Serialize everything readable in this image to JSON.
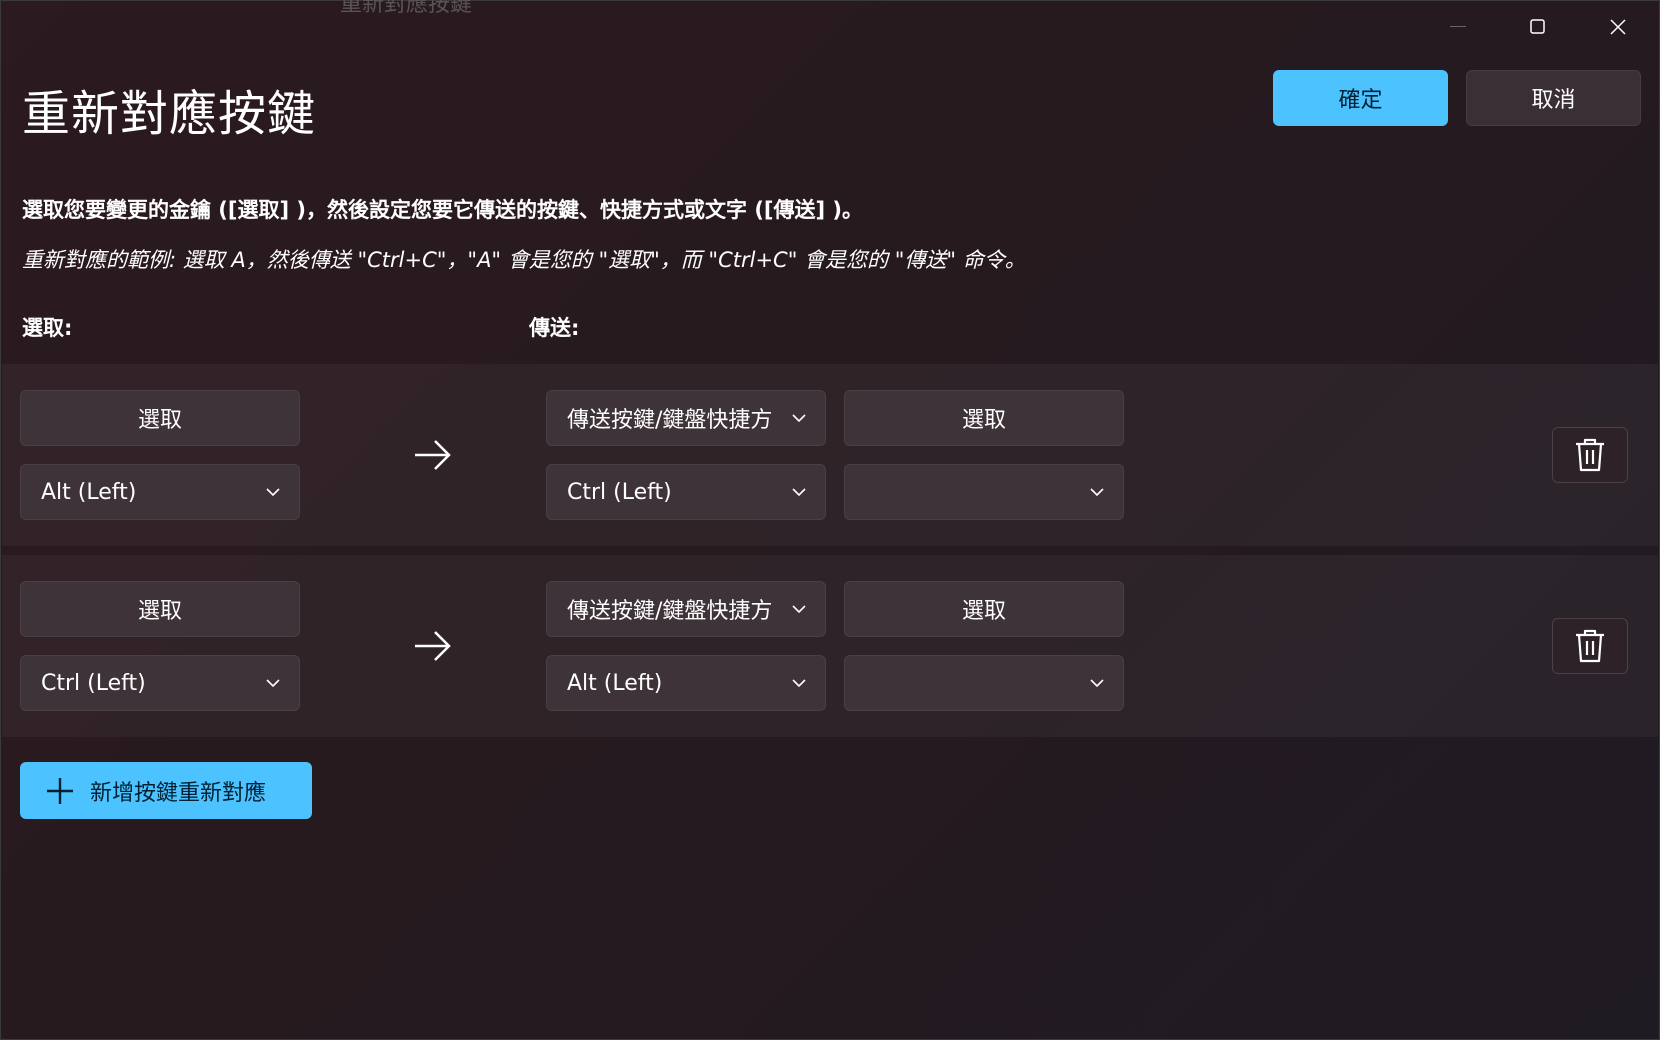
{
  "window": {
    "title": "重新對應按鍵",
    "controls": {
      "minimize": "minimize-icon",
      "maximize": "maximize-icon",
      "close": "close-icon"
    }
  },
  "header": {
    "title": "重新對應按鍵",
    "ok_label": "確定",
    "cancel_label": "取消"
  },
  "instructions": {
    "main": "選取您要變更的金鑰 ([選取] )，然後設定您要它傳送的按鍵、快捷方式或文字 ([傳送] )。",
    "example": "重新對應的範例: 選取 A，然後傳送 \"Ctrl+C\"，\"A\" 會是您的 \"選取\"，而 \"Ctrl+C\" 會是您的 \"傳送\" 命令。"
  },
  "columns": {
    "select": "選取:",
    "send": "傳送:"
  },
  "rows": [
    {
      "select_button": "選取",
      "select_value": "Alt (Left)",
      "send_type": "傳送按鍵/鍵盤快捷方式",
      "send_select_button": "選取",
      "send_value": "Ctrl (Left)",
      "send_value2": ""
    },
    {
      "select_button": "選取",
      "select_value": "Ctrl (Left)",
      "send_type": "傳送按鍵/鍵盤快捷方式",
      "send_select_button": "選取",
      "send_value": "Alt (Left)",
      "send_value2": ""
    }
  ],
  "add_button": {
    "label": "新增按鍵重新對應",
    "icon": "plus-icon"
  },
  "colors": {
    "accent": "#4cc2ff",
    "background": "#261a1f",
    "control": "#3e3338"
  }
}
